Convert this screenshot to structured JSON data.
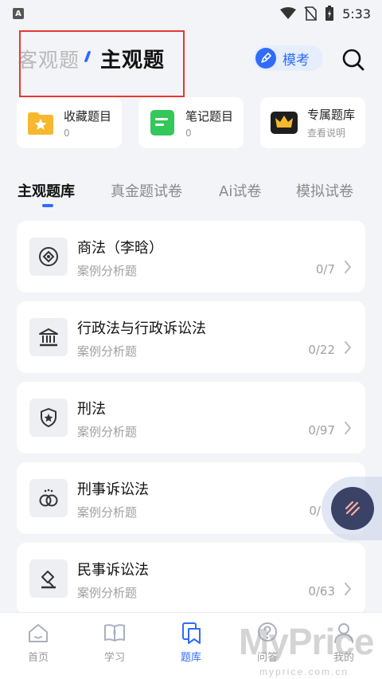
{
  "status_bar": {
    "app_badge": "A",
    "time": "5:33"
  },
  "header": {
    "tab_objective": "客观题",
    "tab_subjective": "主观题",
    "mokao_label": "模考"
  },
  "quick_cards": [
    {
      "title": "收藏题目",
      "sub": "0",
      "icon": "star-folder-icon",
      "color": "#f5b82e"
    },
    {
      "title": "笔记题目",
      "sub": "0",
      "icon": "note-icon",
      "color": "#34c759"
    },
    {
      "title": "专属题库",
      "sub": "查看说明",
      "icon": "crown-icon",
      "color": "#1e1e1e"
    }
  ],
  "category_tabs": [
    {
      "label": "主观题库",
      "active": true
    },
    {
      "label": "真金题试卷",
      "active": false
    },
    {
      "label": "Ai试卷",
      "active": false
    },
    {
      "label": "模拟试卷",
      "active": false
    }
  ],
  "subjects": [
    {
      "title": "商法（李晗）",
      "sub": "案例分析题",
      "count": "0/7",
      "icon": "diamond-badge-icon"
    },
    {
      "title": "行政法与行政诉讼法",
      "sub": "案例分析题",
      "count": "0/22",
      "icon": "government-building-icon"
    },
    {
      "title": "刑法",
      "sub": "案例分析题",
      "count": "0/97",
      "icon": "shield-star-icon"
    },
    {
      "title": "刑事诉讼法",
      "sub": "案例分析题",
      "count": "0/",
      "icon": "handcuffs-icon"
    },
    {
      "title": "民事诉讼法",
      "sub": "案例分析题",
      "count": "0/63",
      "icon": "gavel-icon"
    }
  ],
  "bottom_nav": [
    {
      "label": "首页",
      "icon": "home-icon",
      "active": false
    },
    {
      "label": "学习",
      "icon": "book-icon",
      "active": false
    },
    {
      "label": "题库",
      "icon": "question-bank-icon",
      "active": true
    },
    {
      "label": "问答",
      "icon": "qa-icon",
      "active": false
    },
    {
      "label": "我的",
      "icon": "profile-icon",
      "active": false
    }
  ],
  "watermark": {
    "brand": "MyPrice",
    "url": "myprice.com.cn"
  },
  "colors": {
    "accent": "#2f6bff",
    "highlight_box": "#e53935"
  }
}
